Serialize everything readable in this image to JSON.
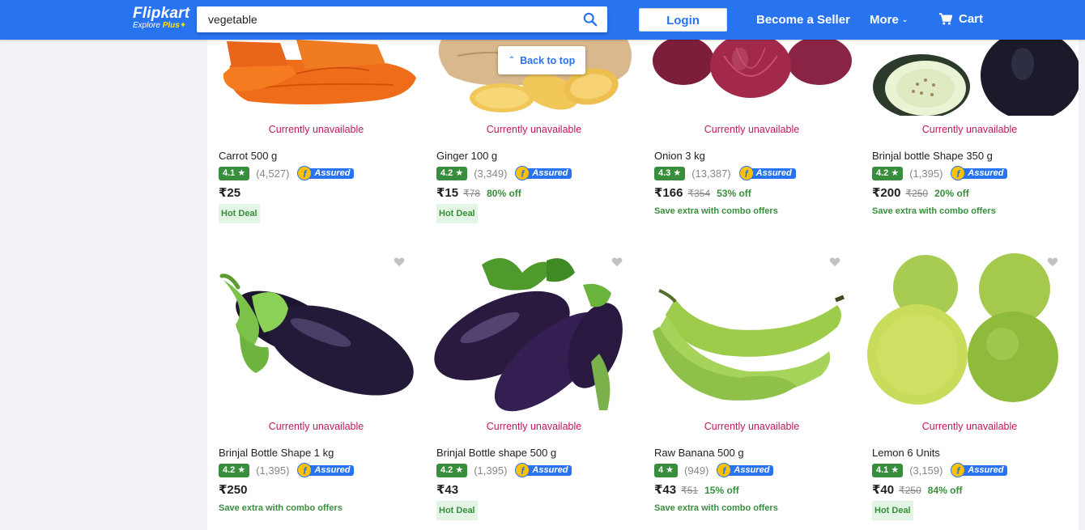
{
  "header": {
    "brand": "Flipkart",
    "tagline_prefix": "Explore",
    "tagline_plus": "Plus",
    "search_value": "vegetable",
    "login_label": "Login",
    "seller_label": "Become a Seller",
    "more_label": "More",
    "cart_label": "Cart"
  },
  "back_to_top": "Back to top",
  "assured_label": "Assured",
  "products": [
    {
      "name": "Carrot 500 g",
      "status": "Currently unavailable",
      "rating": "4.1",
      "reviews": "(4,527)",
      "price": "₹25",
      "mrp": "",
      "off": "",
      "tag": "Hot Deal",
      "tag_type": "hot"
    },
    {
      "name": "Ginger 100 g",
      "status": "Currently unavailable",
      "rating": "4.2",
      "reviews": "(3,349)",
      "price": "₹15",
      "mrp": "₹78",
      "off": "80% off",
      "tag": "Hot Deal",
      "tag_type": "hot"
    },
    {
      "name": "Onion 3 kg",
      "status": "Currently unavailable",
      "rating": "4.3",
      "reviews": "(13,387)",
      "price": "₹166",
      "mrp": "₹354",
      "off": "53% off",
      "tag": "Save extra with combo offers",
      "tag_type": "combo"
    },
    {
      "name": "Brinjal bottle Shape 350 g",
      "status": "Currently unavailable",
      "rating": "4.2",
      "reviews": "(1,395)",
      "price": "₹200",
      "mrp": "₹250",
      "off": "20% off",
      "tag": "Save extra with combo offers",
      "tag_type": "combo"
    },
    {
      "name": "Brinjal Bottle Shape 1 kg",
      "status": "Currently unavailable",
      "rating": "4.2",
      "reviews": "(1,395)",
      "price": "₹250",
      "mrp": "",
      "off": "",
      "tag": "Save extra with combo offers",
      "tag_type": "combo"
    },
    {
      "name": "Brinjal Bottle shape 500 g",
      "status": "Currently unavailable",
      "rating": "4.2",
      "reviews": "(1,395)",
      "price": "₹43",
      "mrp": "",
      "off": "",
      "tag": "Hot Deal",
      "tag_type": "hot"
    },
    {
      "name": "Raw Banana 500 g",
      "status": "Currently unavailable",
      "rating": "4",
      "reviews": "(949)",
      "price": "₹43",
      "mrp": "₹51",
      "off": "15% off",
      "tag": "Save extra with combo offers",
      "tag_type": "combo"
    },
    {
      "name": "Lemon 6 Units",
      "status": "Currently unavailable",
      "rating": "4.1",
      "reviews": "(3,159)",
      "price": "₹40",
      "mrp": "₹250",
      "off": "84% off",
      "tag": "Hot Deal",
      "tag_type": "hot"
    }
  ]
}
